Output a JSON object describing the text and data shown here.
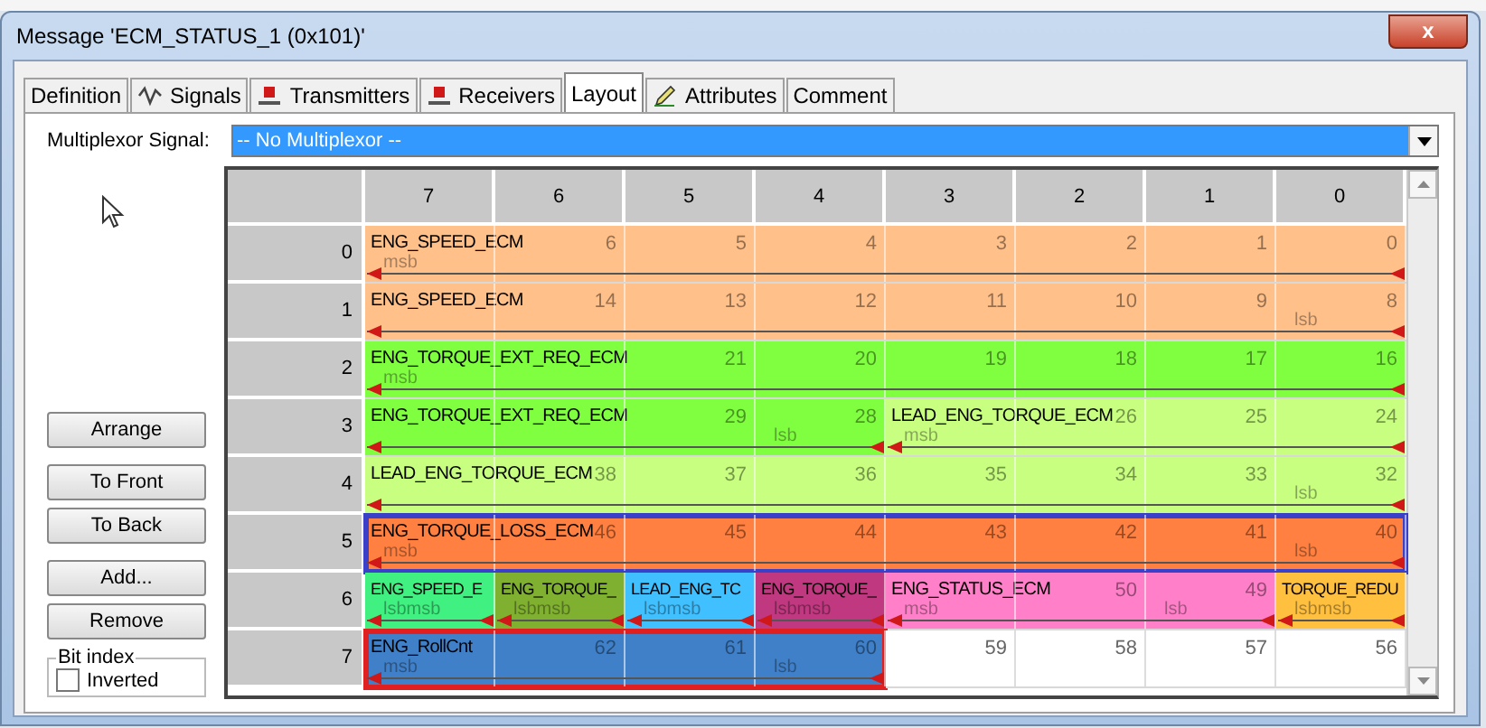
{
  "window": {
    "title": "Message 'ECM_STATUS_1 (0x101)'",
    "close": "x"
  },
  "tabs": [
    {
      "label": "Definition",
      "kind": "plain",
      "selected": false
    },
    {
      "label": "Signals",
      "kind": "signals",
      "selected": false
    },
    {
      "label": "Transmitters",
      "kind": "node",
      "selected": false
    },
    {
      "label": "Receivers",
      "kind": "node",
      "selected": false
    },
    {
      "label": "Layout",
      "kind": "plain",
      "selected": true
    },
    {
      "label": "Attributes",
      "kind": "attr",
      "selected": false
    },
    {
      "label": "Comment",
      "kind": "plain",
      "selected": false
    }
  ],
  "multiplexor": {
    "label": "Multiplexor Signal:",
    "value": "-- No Multiplexor --"
  },
  "buttons": [
    "Arrange",
    "To Front",
    "To Back",
    "Add...",
    "Remove"
  ],
  "bit_index": {
    "title": "Bit index",
    "label": "Inverted",
    "checked": false
  },
  "grid": {
    "columns": [
      "7",
      "6",
      "5",
      "4",
      "3",
      "2",
      "1",
      "0"
    ],
    "rows": [
      {
        "byte": "0",
        "segments": [
          {
            "kind": "signal",
            "label": "ENG_SPEED_ECM",
            "color": "#ffc08a",
            "cells": [
              {
                "mark": "msb"
              },
              {
                "bit": "6"
              },
              {
                "bit": "5"
              },
              {
                "bit": "4"
              },
              {
                "bit": "3"
              },
              {
                "bit": "2"
              },
              {
                "bit": "1"
              },
              {
                "bit": "0"
              }
            ]
          }
        ]
      },
      {
        "byte": "1",
        "segments": [
          {
            "kind": "signal",
            "label": "ENG_SPEED_ECM",
            "color": "#ffc08a",
            "cells": [
              {},
              {
                "bit": "14"
              },
              {
                "bit": "13"
              },
              {
                "bit": "12"
              },
              {
                "bit": "11"
              },
              {
                "bit": "10"
              },
              {
                "bit": "9"
              },
              {
                "bit": "8",
                "mark": "lsb"
              }
            ]
          }
        ]
      },
      {
        "byte": "2",
        "segments": [
          {
            "kind": "signal",
            "label": "ENG_TORQUE_EXT_REQ_ECM",
            "color": "#80ff40",
            "cells": [
              {
                "mark": "msb"
              },
              {},
              {
                "bit": "21"
              },
              {
                "bit": "20"
              },
              {
                "bit": "19"
              },
              {
                "bit": "18"
              },
              {
                "bit": "17"
              },
              {
                "bit": "16"
              }
            ]
          }
        ]
      },
      {
        "byte": "3",
        "segments": [
          {
            "kind": "signal",
            "label": "ENG_TORQUE_EXT_REQ_ECM",
            "color": "#80ff40",
            "cells": [
              {},
              {},
              {
                "bit": "29"
              },
              {
                "bit": "28",
                "mark": "lsb"
              }
            ]
          },
          {
            "kind": "signal",
            "label": "LEAD_ENG_TORQUE_ECM",
            "color": "#c8ff80",
            "cells": [
              {
                "mark": "msb"
              },
              {
                "bit": "26"
              },
              {
                "bit": "25"
              },
              {
                "bit": "24"
              }
            ]
          }
        ]
      },
      {
        "byte": "4",
        "segments": [
          {
            "kind": "signal",
            "label": "LEAD_ENG_TORQUE_ECM",
            "color": "#c8ff80",
            "cells": [
              {},
              {
                "bit": "38"
              },
              {
                "bit": "37"
              },
              {
                "bit": "36"
              },
              {
                "bit": "35"
              },
              {
                "bit": "34"
              },
              {
                "bit": "33"
              },
              {
                "bit": "32",
                "mark": "lsb"
              }
            ]
          }
        ]
      },
      {
        "byte": "5",
        "segments": [
          {
            "kind": "signal",
            "label": "ENG_TORQUE_LOSS_ECM",
            "color": "#ff8040",
            "selected": true,
            "cells": [
              {
                "mark": "msb"
              },
              {
                "bit": "46"
              },
              {
                "bit": "45"
              },
              {
                "bit": "44"
              },
              {
                "bit": "43"
              },
              {
                "bit": "42"
              },
              {
                "bit": "41"
              },
              {
                "bit": "40",
                "mark": "lsb"
              }
            ]
          }
        ]
      },
      {
        "byte": "6",
        "segments": [
          {
            "kind": "signal",
            "label": "ENG_SPEED_E",
            "color": "#40f080",
            "cells": [
              {
                "mark": "lsbmsb"
              }
            ]
          },
          {
            "kind": "signal",
            "label": "ENG_TORQUE_",
            "color": "#80b030",
            "cells": [
              {
                "mark": "lsbmsb"
              }
            ]
          },
          {
            "kind": "signal",
            "label": "LEAD_ENG_TC",
            "color": "#40c0ff",
            "cells": [
              {
                "mark": "lsbmsb"
              }
            ]
          },
          {
            "kind": "signal",
            "label": "ENG_TORQUE_",
            "color": "#c03880",
            "cells": [
              {
                "mark": "lsbmsb"
              }
            ]
          },
          {
            "kind": "signal",
            "label": "ENG_STATUS_ECM",
            "color": "#ff80c8",
            "cells": [
              {
                "mark": "msb"
              },
              {
                "bit": "50"
              },
              {
                "bit": "49",
                "mark": "lsb"
              }
            ]
          },
          {
            "kind": "signal",
            "label": "TORQUE_REDU",
            "color": "#ffc040",
            "cells": [
              {
                "mark": "lsbmsb"
              }
            ]
          }
        ]
      },
      {
        "byte": "7",
        "segments": [
          {
            "kind": "signal",
            "label": "ENG_RollCnt",
            "color": "#4080c8",
            "marked": true,
            "cells": [
              {
                "mark": "msb"
              },
              {
                "bit": "62"
              },
              {
                "bit": "61"
              },
              {
                "bit": "60",
                "mark": "lsb"
              }
            ]
          },
          {
            "kind": "empty",
            "color": "#ffffff",
            "cells": [
              {
                "bit": "59"
              },
              {
                "bit": "58"
              },
              {
                "bit": "57"
              },
              {
                "bit": "56"
              }
            ]
          }
        ]
      }
    ]
  }
}
